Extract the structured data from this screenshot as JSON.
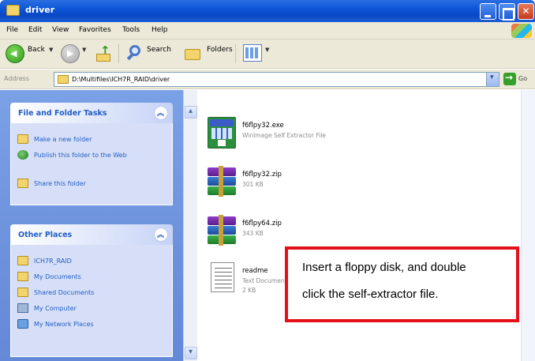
{
  "window": {
    "title": "driver"
  },
  "menu": {
    "items": [
      "File",
      "Edit",
      "View",
      "Favorites",
      "Tools",
      "Help"
    ]
  },
  "toolbar": {
    "back_label": "Back",
    "search_label": "Search",
    "folders_label": "Folders"
  },
  "address": {
    "label": "Address",
    "path": "D:\\Multifiles\\ICH7R_RAID\\driver",
    "go_label": "Go"
  },
  "file_folder_tasks": {
    "title": "File and Folder Tasks",
    "items": [
      {
        "label": "Make a new folder",
        "icon": "folder-icon"
      },
      {
        "label": "Publish this folder to the Web",
        "icon": "globe-icon"
      },
      {
        "label": "Share this folder",
        "icon": "share-folder-icon"
      }
    ]
  },
  "other_places": {
    "title": "Other Places",
    "items": [
      {
        "label": "ICH7R_RAID",
        "icon": "folder-icon"
      },
      {
        "label": "My Documents",
        "icon": "documents-icon"
      },
      {
        "label": "Shared Documents",
        "icon": "shared-folder-icon"
      },
      {
        "label": "My Computer",
        "icon": "computer-icon"
      },
      {
        "label": "My Network Places",
        "icon": "network-icon"
      }
    ]
  },
  "files": [
    {
      "name": "f6flpy32.exe",
      "desc": "WinImage Self Extractor File",
      "icon": "exe-icon"
    },
    {
      "name": "f6flpy32.zip",
      "desc": "301 KB",
      "icon": "zip-icon"
    },
    {
      "name": "f6flpy64.zip",
      "desc": "343 KB",
      "icon": "zip-icon"
    },
    {
      "name": "readme",
      "desc": "Text Document",
      "size": "2 KB",
      "icon": "text-file-icon"
    }
  ],
  "callout": {
    "line1": "Insert a floppy disk, and double",
    "line2": "click the self-extractor file.",
    "border_color": "#e4101a"
  },
  "colors": {
    "titlebar": "#0c55d8",
    "taskpane": "#6f94de",
    "link": "#215dc6"
  }
}
